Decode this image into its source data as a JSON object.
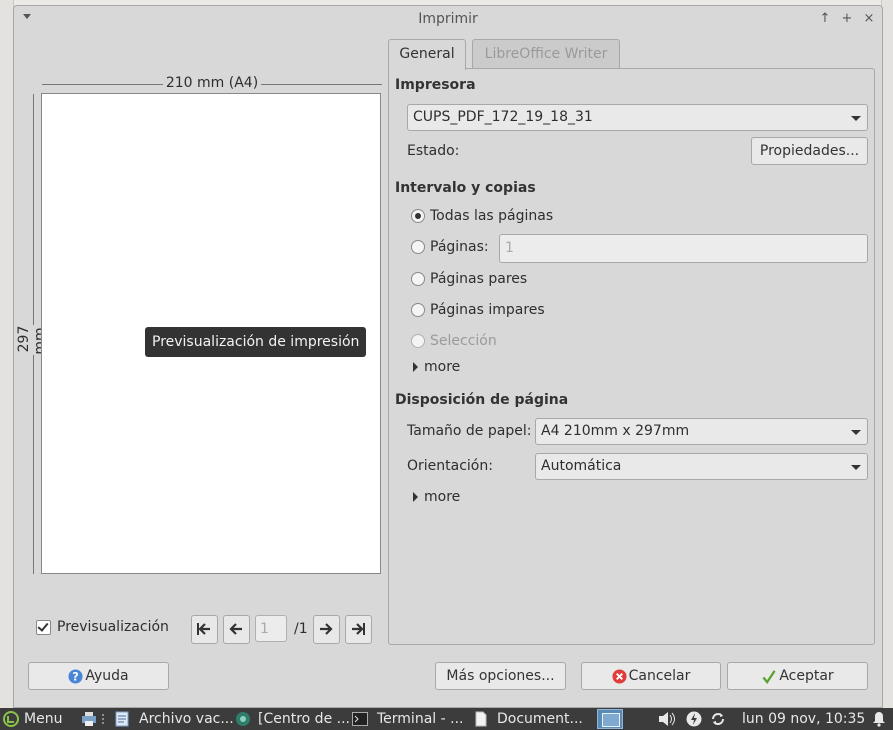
{
  "dialog": {
    "title": "Imprimir",
    "tabs": [
      "General",
      "LibreOffice Writer"
    ]
  },
  "preview": {
    "width_label": "210 mm (A4)",
    "height_label": "297 mm",
    "tooltip": "Previsualización de impresión",
    "checkbox_label": "Previsualización",
    "checkbox_checked": true,
    "page_value": "1",
    "page_total": "/1"
  },
  "printer": {
    "section": "Impresora",
    "selected": "CUPS_PDF_172_19_18_31",
    "status_label": "Estado:",
    "properties_button": "Propiedades..."
  },
  "range": {
    "section": "Intervalo y copias",
    "options": [
      "Todas las páginas",
      "Páginas:",
      "Páginas pares",
      "Páginas impares",
      "Selección"
    ],
    "selected": "Todas las páginas",
    "pages_value": "1",
    "more": "more"
  },
  "layout": {
    "section": "Disposición de página",
    "paper_label": "Tamaño de papel:",
    "paper_value": "A4 210mm x 297mm",
    "orientation_label": "Orientación:",
    "orientation_value": "Automática",
    "more": "more"
  },
  "buttons": {
    "help": "Ayuda",
    "more_options": "Más opciones...",
    "cancel": "Cancelar",
    "ok": "Aceptar"
  },
  "taskbar": {
    "menu": "Menu",
    "items": [
      "Archivo vac...",
      "[Centro de ...",
      "Terminal - ...",
      "Document..."
    ],
    "clock": "lun 09 nov, 10:35"
  },
  "colors": {
    "dialog_bg": "#d8d8d8",
    "taskbar_bg": "#3c3c3c",
    "tooltip_bg": "#333333",
    "cancel_icon": "#e03c3c",
    "ok_icon": "#5aa02c",
    "help_icon": "#4a86d8"
  }
}
